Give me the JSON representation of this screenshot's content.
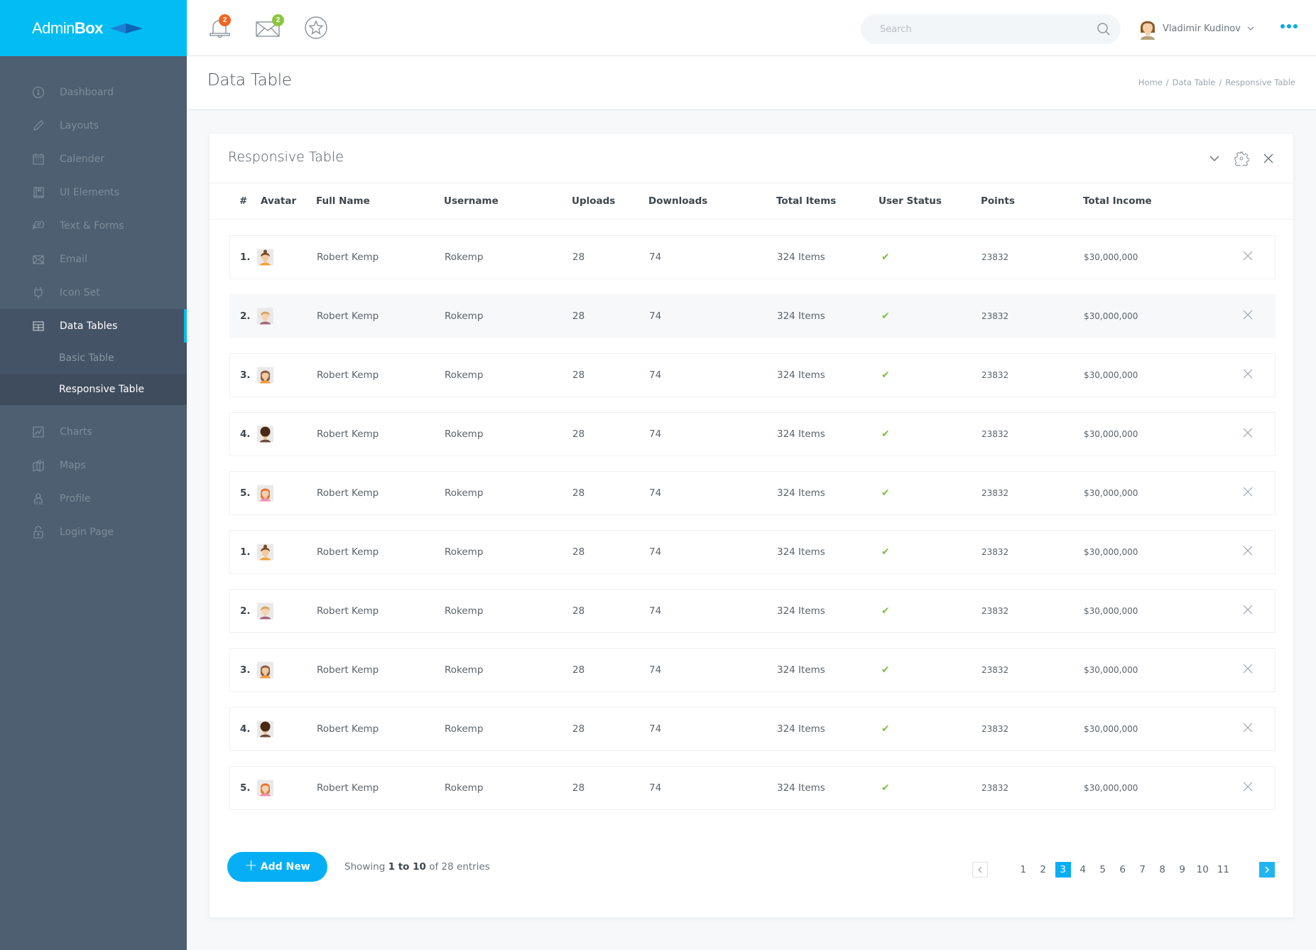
{
  "brand": {
    "name_light": "Admin",
    "name_bold": "Box"
  },
  "topbar": {
    "notifications_count": "2",
    "messages_count": "2",
    "search": {
      "placeholder": "Search",
      "value": ""
    },
    "user_name": "Vladimir Kudinov",
    "colors": {
      "notify_badge": "#f26522",
      "message_badge": "#8cc63f",
      "accent": "#03bdf2"
    }
  },
  "sidebar": {
    "items": [
      {
        "label": "Dashboard",
        "icon": "dashboard-icon"
      },
      {
        "label": "Layouts",
        "icon": "pencil-icon"
      },
      {
        "label": "Calender",
        "icon": "calendar-icon"
      },
      {
        "label": "UI Elements",
        "icon": "book-icon"
      },
      {
        "label": "Text & Forms",
        "icon": "chat-icon"
      },
      {
        "label": "Email",
        "icon": "mail-icon"
      },
      {
        "label": "Icon Set",
        "icon": "plug-icon"
      },
      {
        "label": "Data Tables",
        "icon": "table-icon",
        "active": true,
        "children": [
          {
            "label": "Basic Table"
          },
          {
            "label": "Responsive Table",
            "current": true
          }
        ]
      },
      {
        "label": "Charts",
        "icon": "chart-icon"
      },
      {
        "label": "Maps",
        "icon": "map-icon"
      },
      {
        "label": "Profile",
        "icon": "user-icon"
      },
      {
        "label": "Login Page",
        "icon": "lock-icon"
      }
    ]
  },
  "page": {
    "title": "Data Table",
    "breadcrumb": [
      "Home",
      "Data Table",
      "Responsive Table"
    ]
  },
  "card": {
    "title": "Responsive Table",
    "columns": [
      "#",
      "Avatar",
      "Full Name",
      "Username",
      "Uploads",
      "Downloads",
      "Total Items",
      "User Status",
      "Points",
      "Total Income"
    ],
    "rows": [
      {
        "index": "1.",
        "avatar": "brown-bun",
        "full_name": "Robert Kemp",
        "username": "Rokemp",
        "uploads": "28",
        "downloads": "74",
        "total_items": "324 Items",
        "status": "active",
        "points": "23832",
        "income": "$30,000,000"
      },
      {
        "index": "2.",
        "avatar": "blonde",
        "full_name": "Robert Kemp",
        "username": "Rokemp",
        "uploads": "28",
        "downloads": "74",
        "total_items": "324 Items",
        "status": "active",
        "points": "23832",
        "income": "$30,000,000"
      },
      {
        "index": "3.",
        "avatar": "brown-long",
        "full_name": "Robert Kemp",
        "username": "Rokemp",
        "uploads": "28",
        "downloads": "74",
        "total_items": "324 Items",
        "status": "active",
        "points": "23832",
        "income": "$30,000,000"
      },
      {
        "index": "4.",
        "avatar": "dark-curly",
        "full_name": "Robert Kemp",
        "username": "Rokemp",
        "uploads": "28",
        "downloads": "74",
        "total_items": "324 Items",
        "status": "active",
        "points": "23832",
        "income": "$30,000,000"
      },
      {
        "index": "5.",
        "avatar": "redhead",
        "full_name": "Robert Kemp",
        "username": "Rokemp",
        "uploads": "28",
        "downloads": "74",
        "total_items": "324 Items",
        "status": "active",
        "points": "23832",
        "income": "$30,000,000"
      },
      {
        "index": "1.",
        "avatar": "brown-bun",
        "full_name": "Robert Kemp",
        "username": "Rokemp",
        "uploads": "28",
        "downloads": "74",
        "total_items": "324 Items",
        "status": "active",
        "points": "23832",
        "income": "$30,000,000"
      },
      {
        "index": "2.",
        "avatar": "blonde",
        "full_name": "Robert Kemp",
        "username": "Rokemp",
        "uploads": "28",
        "downloads": "74",
        "total_items": "324 Items",
        "status": "active",
        "points": "23832",
        "income": "$30,000,000"
      },
      {
        "index": "3.",
        "avatar": "brown-long",
        "full_name": "Robert Kemp",
        "username": "Rokemp",
        "uploads": "28",
        "downloads": "74",
        "total_items": "324 Items",
        "status": "active",
        "points": "23832",
        "income": "$30,000,000"
      },
      {
        "index": "4.",
        "avatar": "dark-curly",
        "full_name": "Robert Kemp",
        "username": "Rokemp",
        "uploads": "28",
        "downloads": "74",
        "total_items": "324 Items",
        "status": "active",
        "points": "23832",
        "income": "$30,000,000"
      },
      {
        "index": "5.",
        "avatar": "redhead",
        "full_name": "Robert Kemp",
        "username": "Rokemp",
        "uploads": "28",
        "downloads": "74",
        "total_items": "324 Items",
        "status": "active",
        "points": "23832",
        "income": "$30,000,000"
      }
    ],
    "highlighted_row": 1,
    "add_button_label": "Add New",
    "showing": {
      "prefix": "Showing",
      "range": "1 to 10",
      "middle": "of",
      "total": "28",
      "suffix": "entries"
    },
    "pagination": {
      "pages": [
        "1",
        "2",
        "3",
        "4",
        "5",
        "6",
        "7",
        "8",
        "9",
        "10",
        "11"
      ],
      "current": "3"
    },
    "status_color": "#7cc142"
  }
}
